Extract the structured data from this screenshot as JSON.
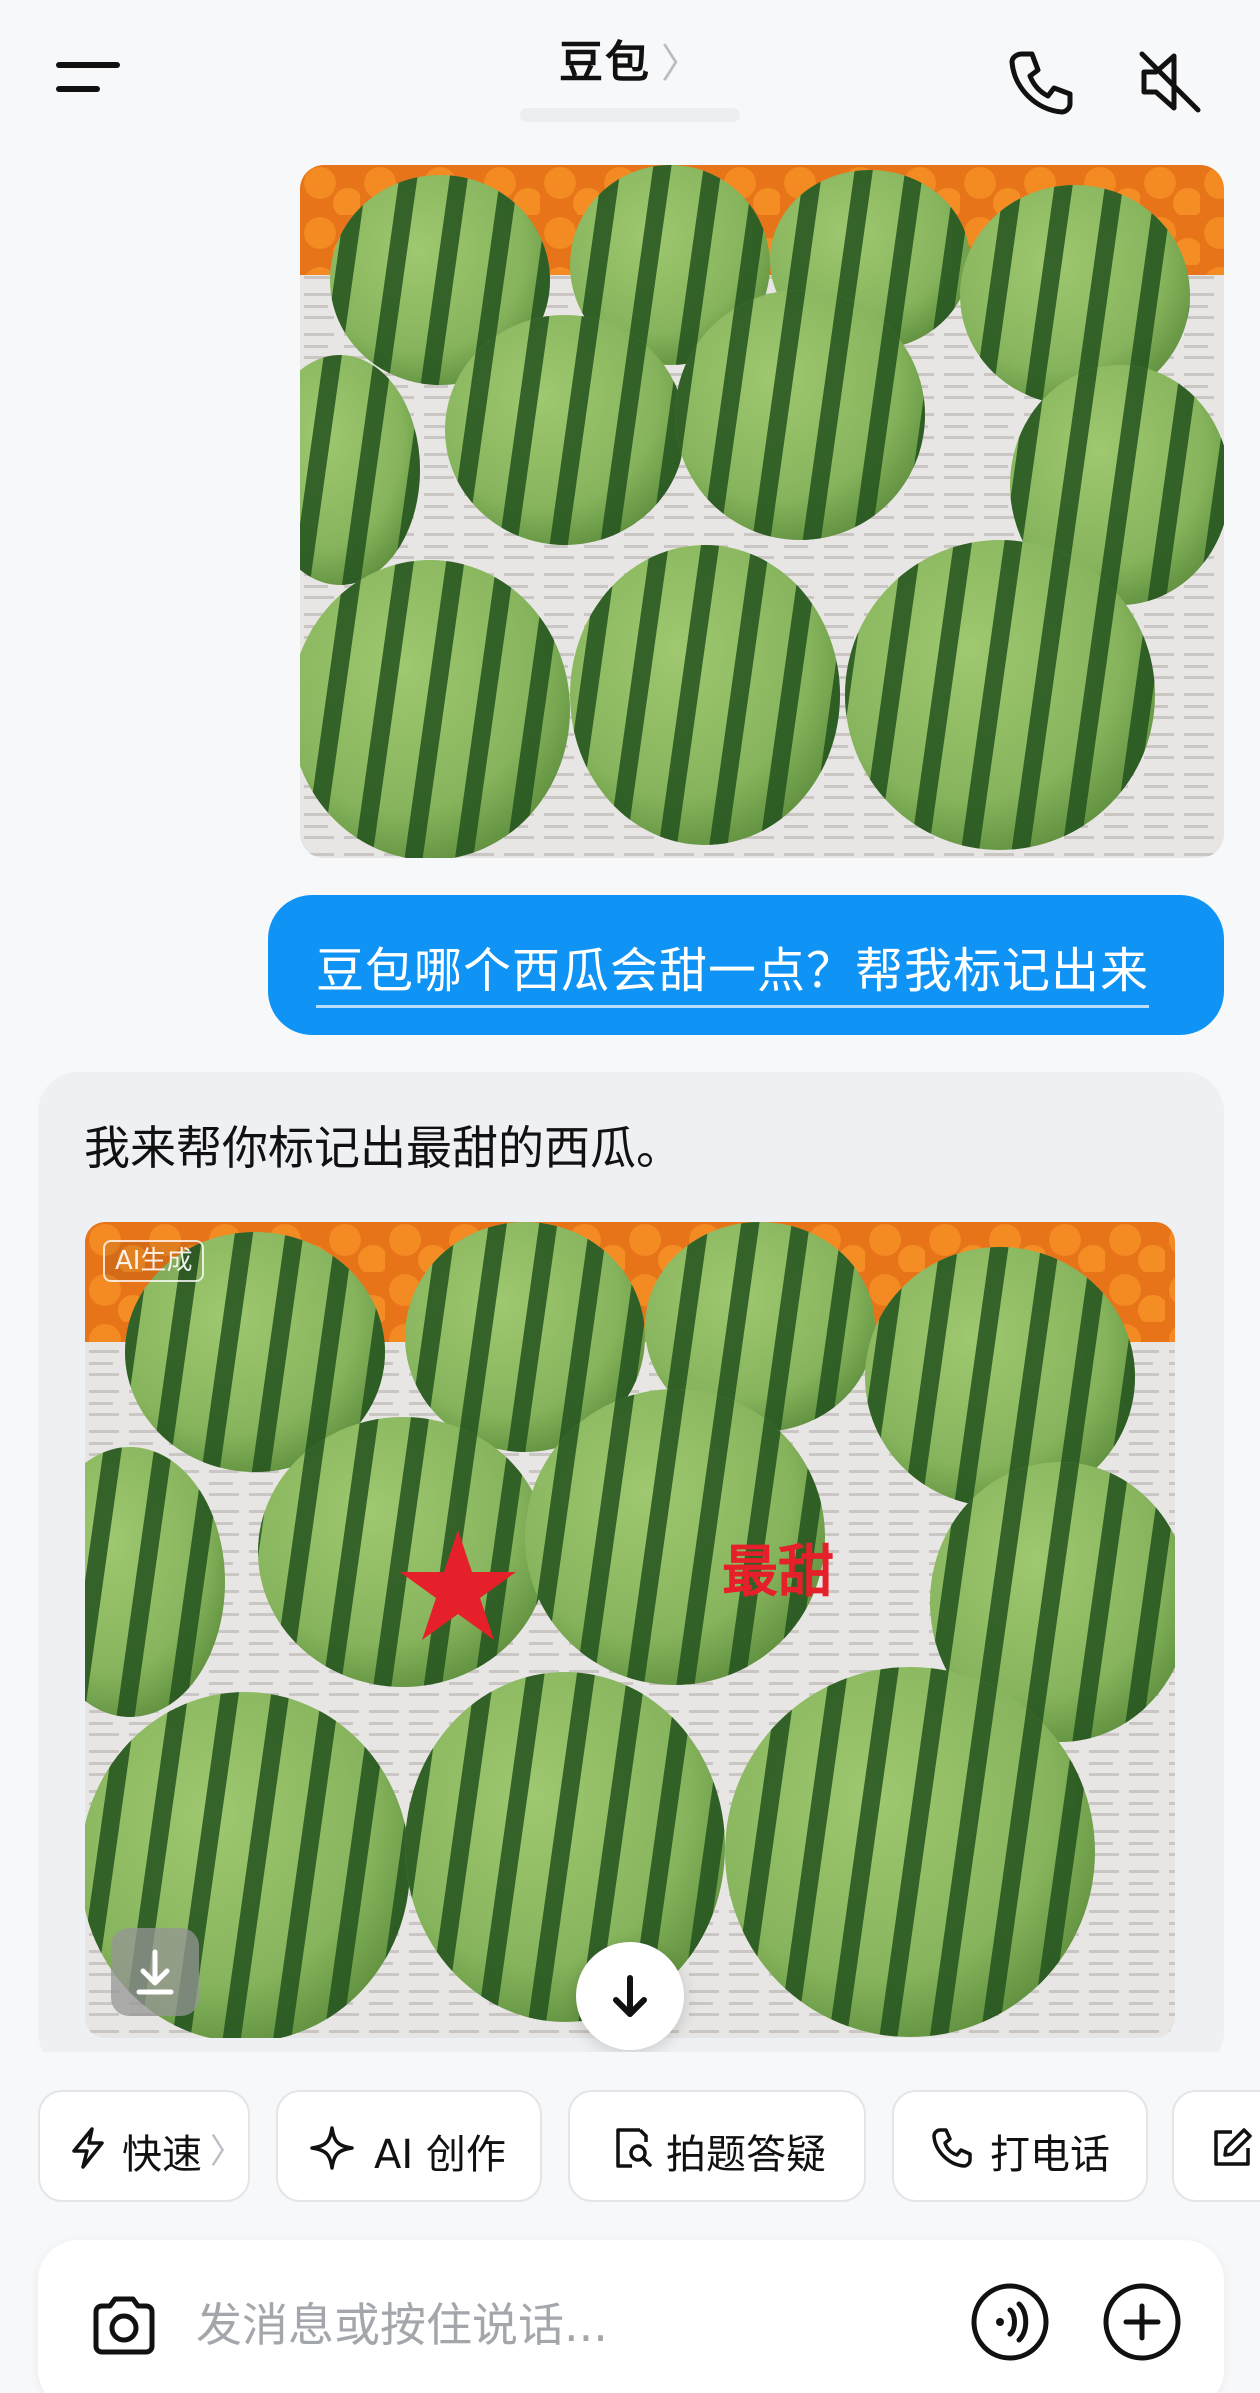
{
  "header": {
    "title": "豆包",
    "title_chevron": "〉"
  },
  "conversation": {
    "user_message": "豆包哪个西瓜会甜一点？帮我标记出来",
    "bot_message": "我来帮你标记出最甜的西瓜。",
    "ai_tag": "AI生成",
    "marker_label": "最甜"
  },
  "quick_actions": [
    {
      "label": "快速",
      "icon": "lightning-icon"
    },
    {
      "label": "AI 创作",
      "icon": "sparkle-icon"
    },
    {
      "label": "拍题答疑",
      "icon": "photo-search-icon"
    },
    {
      "label": "打电话",
      "icon": "phone-icon"
    },
    {
      "label": "",
      "icon": "edit-icon"
    }
  ],
  "quick_chevron": "〉",
  "input": {
    "placeholder": "发消息或按住说话..."
  },
  "colors": {
    "user_bubble": "#0f94f5",
    "marker_red": "#e6202a",
    "background": "#f7f8fa"
  }
}
